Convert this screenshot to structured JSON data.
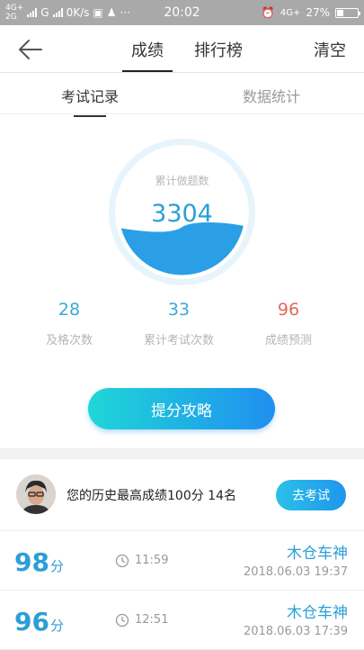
{
  "status_bar": {
    "net_top": "4G+",
    "net_bottom": "2G",
    "carrier_g": "G",
    "speed": "0K/s",
    "time": "20:02",
    "net_right": "4G+",
    "battery": "27%"
  },
  "nav": {
    "tab_scores": "成绩",
    "tab_ranking": "排行榜",
    "clear": "清空"
  },
  "subtabs": {
    "records": "考试记录",
    "stats": "数据统计"
  },
  "gauge": {
    "label": "累计做题数",
    "value": "3304",
    "fill_fraction": 0.38,
    "color": "#2a9fe6"
  },
  "stats": [
    {
      "value": "28",
      "label": "及格次数"
    },
    {
      "value": "33",
      "label": "累计考试次数"
    },
    {
      "value": "96",
      "label": "成绩预测"
    }
  ],
  "cta_label": "提分攻略",
  "best": {
    "text": "您的历史最高成绩100分  14名",
    "button": "去考试"
  },
  "records": [
    {
      "score": "98",
      "unit": "分",
      "duration": "11:59",
      "name": "木仓车神",
      "date": "2018.06.03  19:37"
    },
    {
      "score": "96",
      "unit": "分",
      "duration": "12:51",
      "name": "木仓车神",
      "date": "2018.06.03  17:39"
    }
  ],
  "icons": {
    "back": "arrow-left-icon",
    "clock": "clock-icon"
  }
}
